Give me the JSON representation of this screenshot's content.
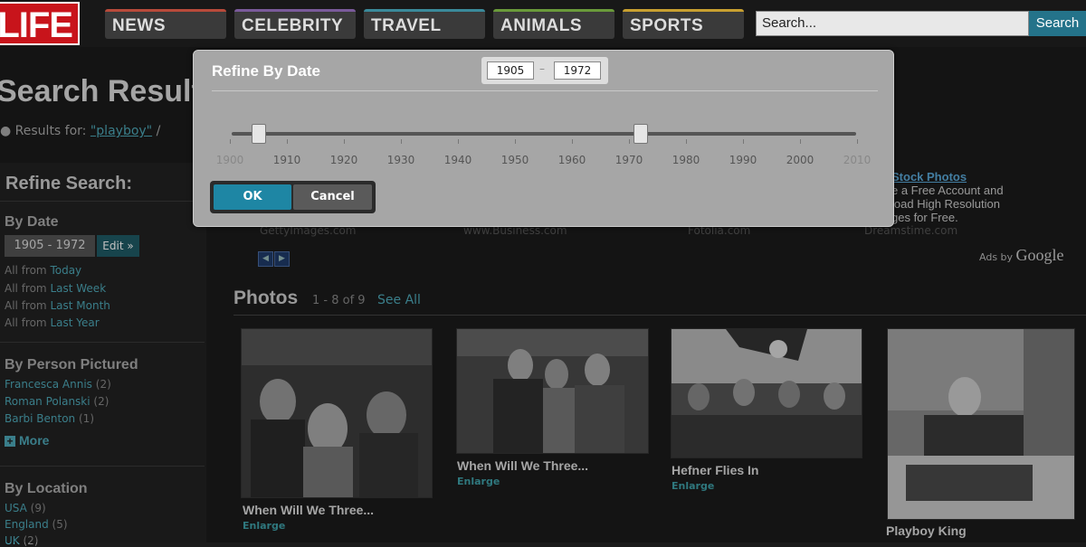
{
  "header": {
    "logo": "LIFE",
    "nav": [
      {
        "label": "NEWS",
        "accent": "#b84a3a"
      },
      {
        "label": "CELEBRITY",
        "accent": "#7a5a9a"
      },
      {
        "label": "TRAVEL",
        "accent": "#3a8a9a"
      },
      {
        "label": "ANIMALS",
        "accent": "#6a9a3a"
      },
      {
        "label": "SPORTS",
        "accent": "#c8a030"
      }
    ],
    "search_placeholder": "Search...",
    "search_button": "Search"
  },
  "page": {
    "title": "Search Results",
    "results_for_label": "Results for:",
    "query": "\"playboy\"",
    "separator": "/"
  },
  "sidebar": {
    "title": "Refine Search:",
    "by_date": {
      "heading": "By Date",
      "range": "1905 - 1972",
      "edit": "Edit »",
      "options": [
        {
          "prefix": "All from",
          "link": "Today"
        },
        {
          "prefix": "All from",
          "link": "Last Week"
        },
        {
          "prefix": "All from",
          "link": "Last Month"
        },
        {
          "prefix": "All from",
          "link": "Last Year"
        }
      ]
    },
    "by_person": {
      "heading": "By Person Pictured",
      "items": [
        {
          "name": "Francesca Annis",
          "count": "(2)"
        },
        {
          "name": "Roman Polanski",
          "count": "(2)"
        },
        {
          "name": "Barbi Benton",
          "count": "(1)"
        }
      ],
      "more": "More"
    },
    "by_location": {
      "heading": "By Location",
      "items": [
        {
          "name": "USA",
          "count": "(9)"
        },
        {
          "name": "England",
          "count": "(5)"
        },
        {
          "name": "UK",
          "count": "(2)"
        }
      ]
    }
  },
  "ads": {
    "sources": [
      "GettyImages.com",
      "www.Business.com",
      "Fotolia.com",
      "Dreamstime.com"
    ],
    "right_heading": "Stock Photos",
    "right_lines": [
      "e a Free Account and",
      "load High Resolution",
      "ges for Free."
    ],
    "ads_by": "Ads by",
    "google": "Google"
  },
  "photos": {
    "heading": "Photos",
    "count": "1 - 8 of 9",
    "see_all": "See All",
    "items": [
      {
        "caption": "When Will We Three...",
        "enlarge": "Enlarge"
      },
      {
        "caption": "When Will We Three...",
        "enlarge": "Enlarge"
      },
      {
        "caption": "Hefner Flies In",
        "enlarge": "Enlarge"
      },
      {
        "caption": "Playboy King",
        "enlarge": ""
      }
    ]
  },
  "modal": {
    "title": "Refine By Date",
    "from": "1905",
    "to": "1972",
    "range_separator": "–",
    "slider": {
      "min": 1900,
      "max": 2010,
      "from": 1905,
      "to": 1972
    },
    "ticks": [
      "1900",
      "1910",
      "1920",
      "1930",
      "1940",
      "1950",
      "1960",
      "1970",
      "1980",
      "1990",
      "2000",
      "2010"
    ],
    "ok": "OK",
    "cancel": "Cancel"
  }
}
